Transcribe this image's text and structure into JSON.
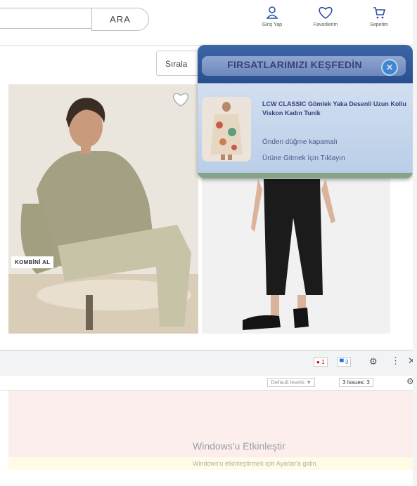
{
  "header": {
    "search_button": "ARA",
    "login_label": "Giriş Yap",
    "favorites_label": "Favorilerim",
    "cart_label": "Sepetim"
  },
  "toolbar": {
    "sort_label": "Sırala"
  },
  "product1": {
    "badge": "KOMBİNİ AL"
  },
  "popup": {
    "title": "FIRSATLARIMIZI KEŞFEDİN",
    "close": "✕",
    "product_name": "LCW CLASSIC Gömlek Yaka Desenli Uzun Kollu Viskon Kadın Tunik",
    "description": "Önden düğme kapamalı",
    "link": "Ürüne Gitmek İçin Tıklayın"
  },
  "devtools": {
    "errors": "1",
    "messages": "3",
    "levels": "Default levels ▼",
    "issues": "3 Issues: 3"
  },
  "windows": {
    "title": "Windows'u Etkinleştir",
    "subtitle": "Windows'u etkinleştirmek için Ayarlar'a gidin."
  },
  "colors": {
    "popup_bar": "#2f5597",
    "accent": "#3f86cf"
  }
}
